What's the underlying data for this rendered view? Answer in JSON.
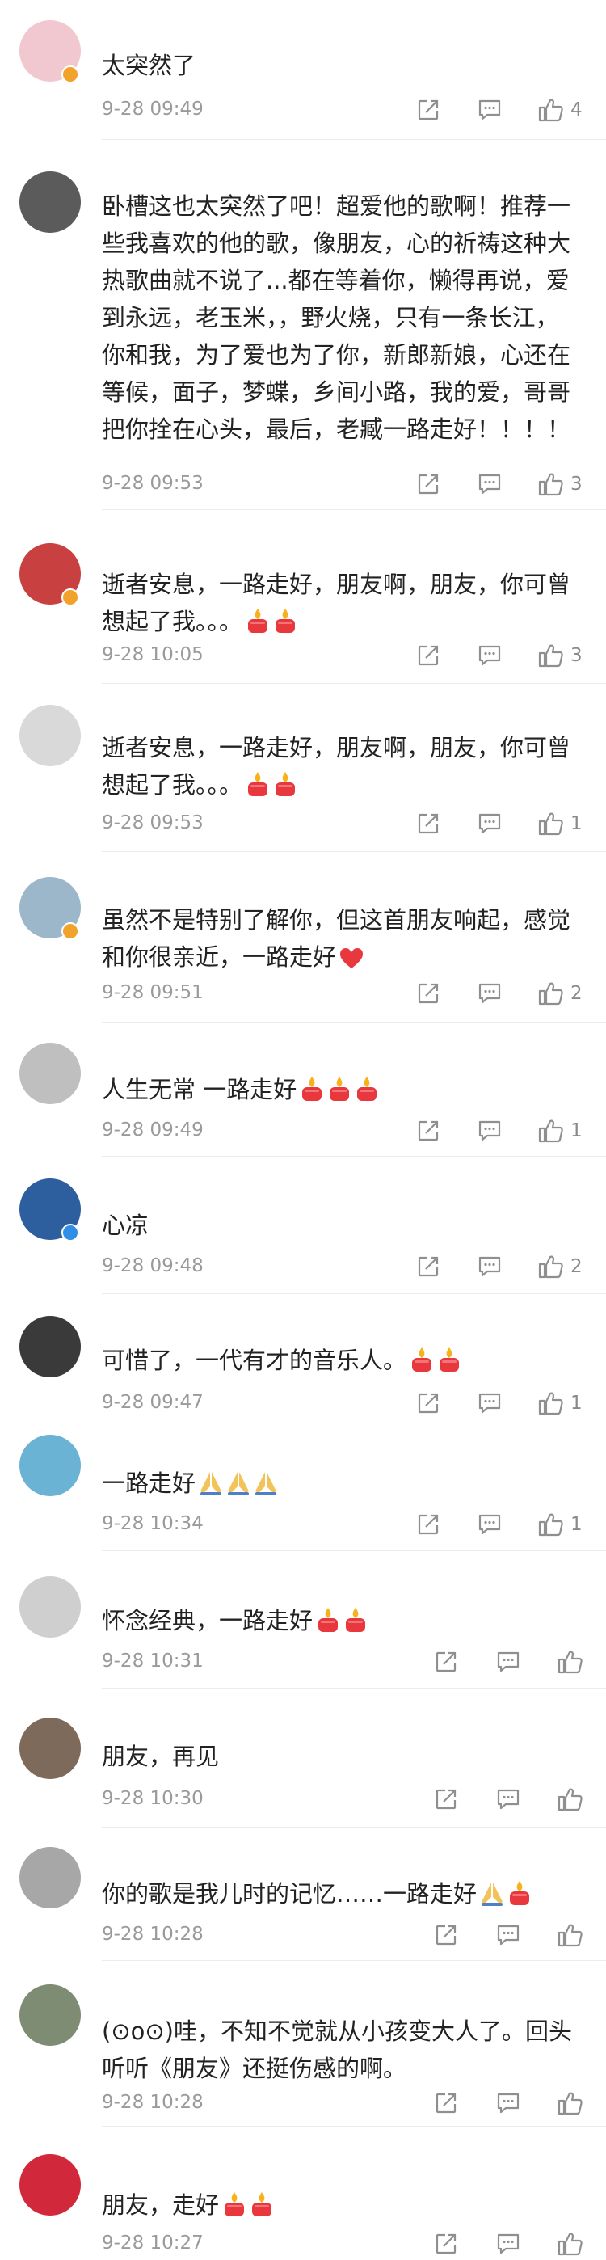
{
  "comments": [
    {
      "text": "太突然了",
      "time": "9-28 09:49",
      "likes": "4",
      "emojis": []
    },
    {
      "text": "卧槽这也太突然了吧！超爱他的歌啊！推荐一些我喜欢的他的歌，像朋友，心的祈祷这种大热歌曲就不说了...都在等着你，懒得再说，爱到永远，老玉米，，野火烧，只有一条长江，你和我，为了爱也为了你，新郎新娘，心还在等候，面子，梦蝶，乡间小路，我的爱，哥哥把你拴在心头，最后，老臧一路走好！！！！",
      "time": "9-28 09:53",
      "likes": "3",
      "emojis": []
    },
    {
      "text": "逝者安息，一路走好，朋友啊，朋友，你可曾想起了我。。。",
      "time": "9-28 10:05",
      "likes": "3",
      "emojis": [
        "candle-icon",
        "candle-icon"
      ]
    },
    {
      "text": "逝者安息，一路走好，朋友啊，朋友，你可曾想起了我。。。",
      "time": "9-28 09:53",
      "likes": "1",
      "emojis": [
        "candle-icon",
        "candle-icon"
      ]
    },
    {
      "text": "虽然不是特别了解你，但这首朋友响起，感觉和你很亲近，一路走好",
      "time": "9-28 09:51",
      "likes": "2",
      "emojis": [
        "heart-icon"
      ]
    },
    {
      "text": "人生无常 一路走好",
      "time": "9-28 09:49",
      "likes": "1",
      "emojis": [
        "candle-icon",
        "candle-icon",
        "candle-icon"
      ]
    },
    {
      "text": "心凉",
      "time": "9-28 09:48",
      "likes": "2",
      "emojis": []
    },
    {
      "text": "可惜了，一代有才的音乐人。",
      "time": "9-28 09:47",
      "likes": "1",
      "emojis": [
        "candle-icon",
        "candle-icon"
      ]
    },
    {
      "text": "一路走好",
      "time": "9-28 10:34",
      "likes": "1",
      "emojis": [
        "pray-icon",
        "pray-icon",
        "pray-icon"
      ]
    },
    {
      "text": "怀念经典，一路走好",
      "time": "9-28 10:31",
      "likes": "",
      "emojis": [
        "candle-icon",
        "candle-icon"
      ]
    },
    {
      "text": "朋友，再见",
      "time": "9-28 10:30",
      "likes": "",
      "emojis": []
    },
    {
      "text": "你的歌是我儿时的记忆……一路走好",
      "time": "9-28 10:28",
      "likes": "",
      "emojis": [
        "pray-icon",
        "candle-icon"
      ]
    },
    {
      "text": "(⊙o⊙)哇，不知不觉就从小孩变大人了。回头听听《朋友》还挺伤感的啊。",
      "time": "9-28 10:28",
      "likes": "",
      "emojis": []
    },
    {
      "text": "朋友，走好",
      "time": "9-28 10:27",
      "likes": "",
      "emojis": [
        "candle-icon",
        "candle-icon"
      ]
    }
  ],
  "colors": {
    "verify_gold": "#f0a22b",
    "verify_blue": "#2f8ee6",
    "candle_red": "#e8383d",
    "heart_red": "#e8383d"
  }
}
